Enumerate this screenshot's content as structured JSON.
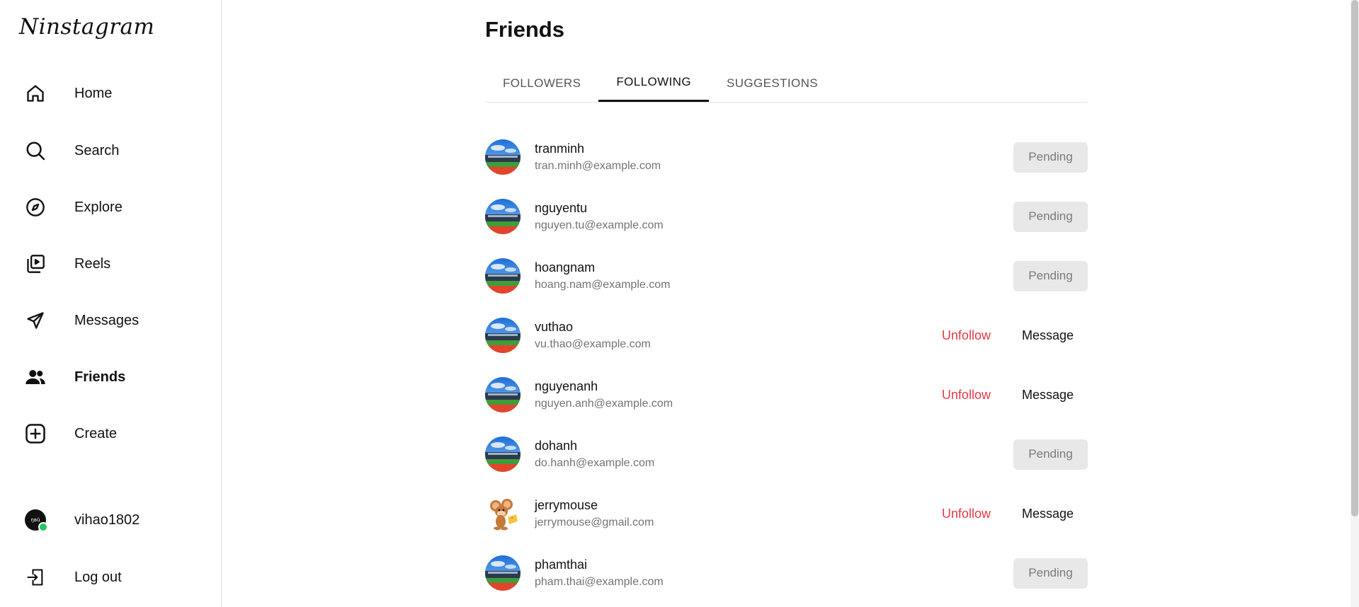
{
  "app": {
    "logo": "Ninstagram"
  },
  "sidebar": {
    "items": [
      {
        "label": "Home",
        "icon": "home-icon"
      },
      {
        "label": "Search",
        "icon": "search-icon"
      },
      {
        "label": "Explore",
        "icon": "compass-icon"
      },
      {
        "label": "Reels",
        "icon": "reels-icon"
      },
      {
        "label": "Messages",
        "icon": "send-icon"
      },
      {
        "label": "Friends",
        "icon": "people-icon"
      },
      {
        "label": "Create",
        "icon": "plus-square-icon"
      }
    ],
    "profile": {
      "username": "vihao1802",
      "avatar_text": "ŋвŭ",
      "status": "online"
    },
    "logout": {
      "label": "Log out",
      "icon": "logout-icon"
    }
  },
  "main": {
    "title": "Friends",
    "tabs": [
      {
        "label": "FOLLOWERS",
        "active": false
      },
      {
        "label": "FOLLOWING",
        "active": true
      },
      {
        "label": "SUGGESTIONS",
        "active": false
      }
    ],
    "users": [
      {
        "username": "tranminh",
        "email": "tran.minh@example.com",
        "status": "pending",
        "avatar": "stadium"
      },
      {
        "username": "nguyentu",
        "email": "nguyen.tu@example.com",
        "status": "pending",
        "avatar": "stadium"
      },
      {
        "username": "hoangnam",
        "email": "hoang.nam@example.com",
        "status": "pending",
        "avatar": "stadium"
      },
      {
        "username": "vuthao",
        "email": "vu.thao@example.com",
        "status": "following",
        "avatar": "stadium"
      },
      {
        "username": "nguyenanh",
        "email": "nguyen.anh@example.com",
        "status": "following",
        "avatar": "stadium"
      },
      {
        "username": "dohanh",
        "email": "do.hanh@example.com",
        "status": "pending",
        "avatar": "stadium"
      },
      {
        "username": "jerrymouse",
        "email": "jerrymouse@gmail.com",
        "status": "following",
        "avatar": "mouse"
      },
      {
        "username": "phamthai",
        "email": "pham.thai@example.com",
        "status": "pending",
        "avatar": "stadium"
      }
    ],
    "labels": {
      "pending": "Pending",
      "unfollow": "Unfollow",
      "message": "Message"
    }
  },
  "colors": {
    "unfollow": "#e63946",
    "pending_bg": "#e8e8e8",
    "online": "#22c55e"
  }
}
